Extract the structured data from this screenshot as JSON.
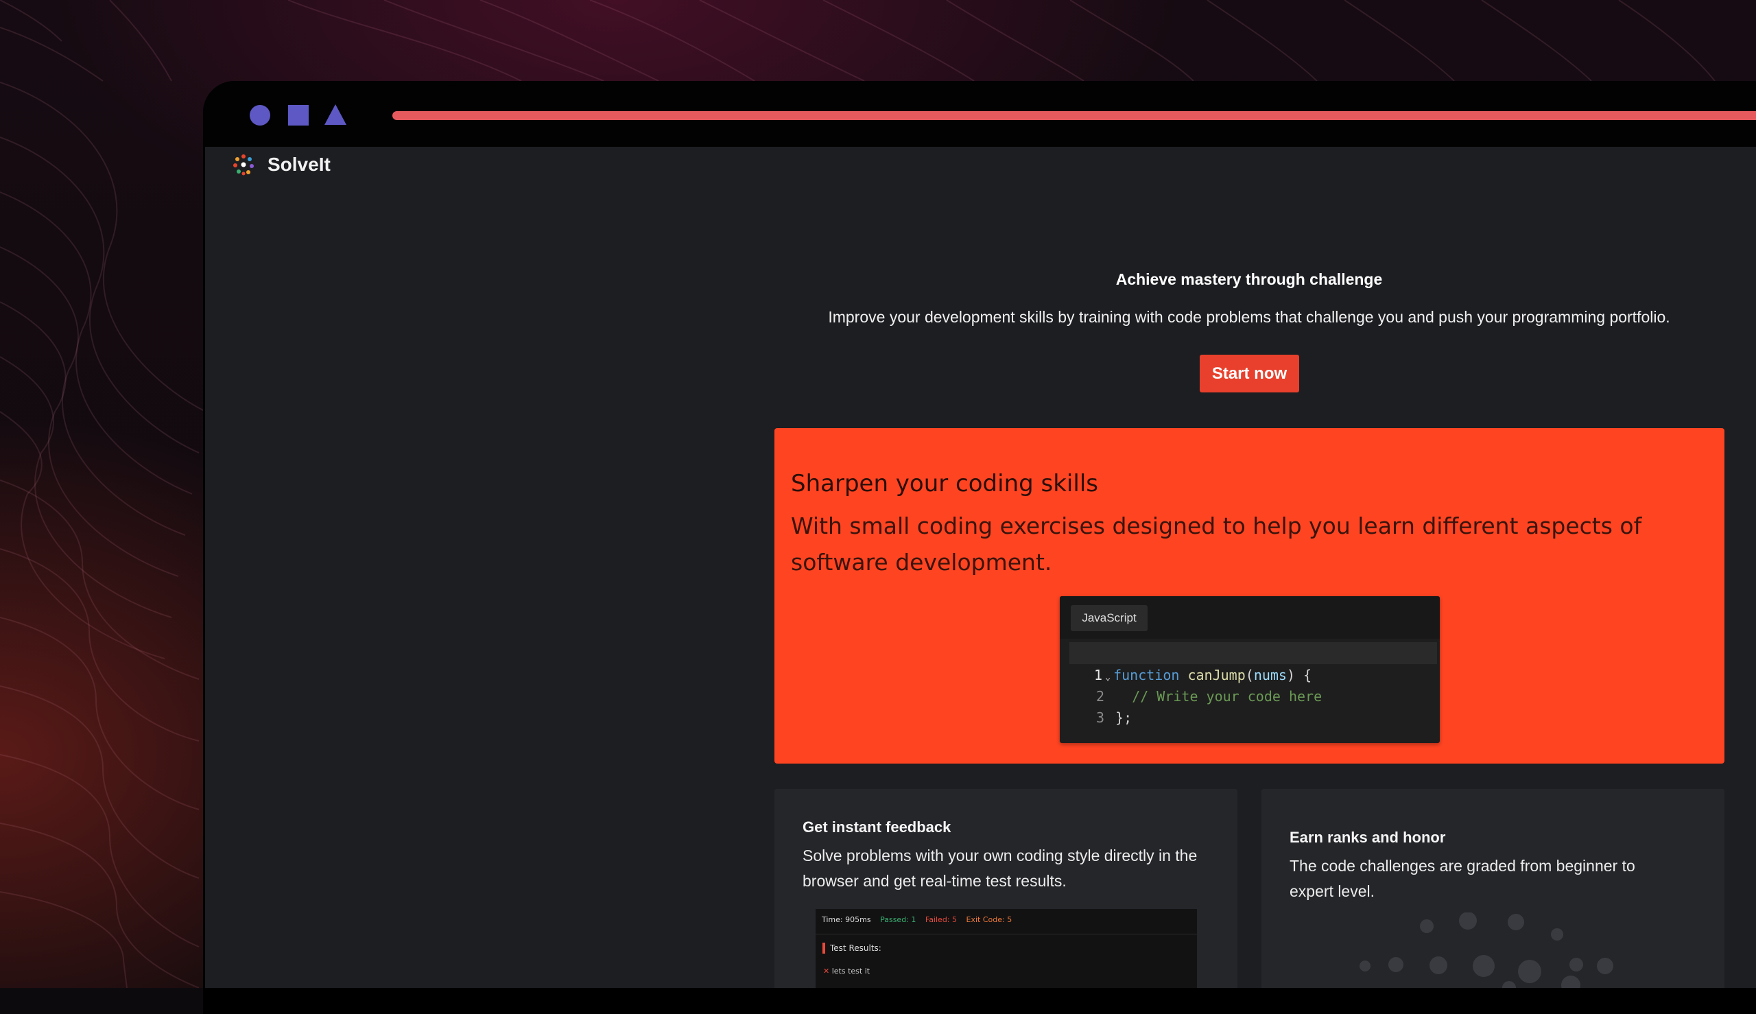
{
  "browser": {
    "tab_shapes": [
      "circle",
      "square",
      "triangle"
    ],
    "accent_color": "#e65a5e",
    "shape_color": "#5d58c4"
  },
  "navbar": {
    "brand": "SolveIt",
    "logo_icon": "solveit-logo"
  },
  "hero": {
    "title": "Achieve mastery through challenge",
    "subtitle": "Improve your development skills by training with code problems that challenge you and push your programming portfolio.",
    "cta_label": "Start now",
    "cta_color": "#e8402c"
  },
  "feature_main": {
    "title": "Sharpen your coding skills",
    "description": "With small coding exercises designed to help you learn different aspects of software development.",
    "background_color": "#ff4422",
    "editor": {
      "tab_label": "JavaScript",
      "lines": [
        {
          "number": "1",
          "keyword": "function",
          "name": "canJump",
          "open": "(",
          "param": "nums",
          "close": ") {"
        },
        {
          "number": "2",
          "comment": "// Write your code here"
        },
        {
          "number": "3",
          "text": "};"
        }
      ]
    }
  },
  "feature_feedback": {
    "title": "Get instant feedback",
    "description": "Solve problems with your own coding style directly in the browser and get real-time test results.",
    "test_panel": {
      "time": "Time: 905ms",
      "passed": "Passed: 1",
      "failed": "Failed: 5",
      "exit_code": "Exit Code: 5",
      "results_label": "Test Results:",
      "item": "lets test it"
    }
  },
  "feature_ranks": {
    "title": "Earn ranks and honor",
    "description": "The code challenges are graded from beginner to expert level."
  }
}
